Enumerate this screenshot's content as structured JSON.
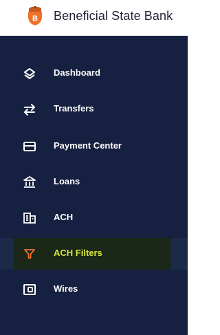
{
  "header": {
    "bank_name": "Beneficial State Bank",
    "logo_icon": "acorn-logo",
    "logo_color": "#f0712b"
  },
  "sidebar": {
    "background": "#162040",
    "active_label_color": "#d6e63a",
    "active_icon_color": "#f0712b",
    "items": [
      {
        "label": "Dashboard",
        "icon": "layers-icon"
      },
      {
        "label": "Transfers",
        "icon": "transfer-arrows-icon"
      },
      {
        "label": "Payment Center",
        "icon": "card-icon"
      },
      {
        "label": "Loans",
        "icon": "bank-building-icon"
      },
      {
        "label": "ACH",
        "icon": "ach-building-icon"
      },
      {
        "label": "ACH Filters",
        "icon": "filter-icon",
        "active": true
      },
      {
        "label": "Wires",
        "icon": "wallet-icon"
      }
    ]
  }
}
